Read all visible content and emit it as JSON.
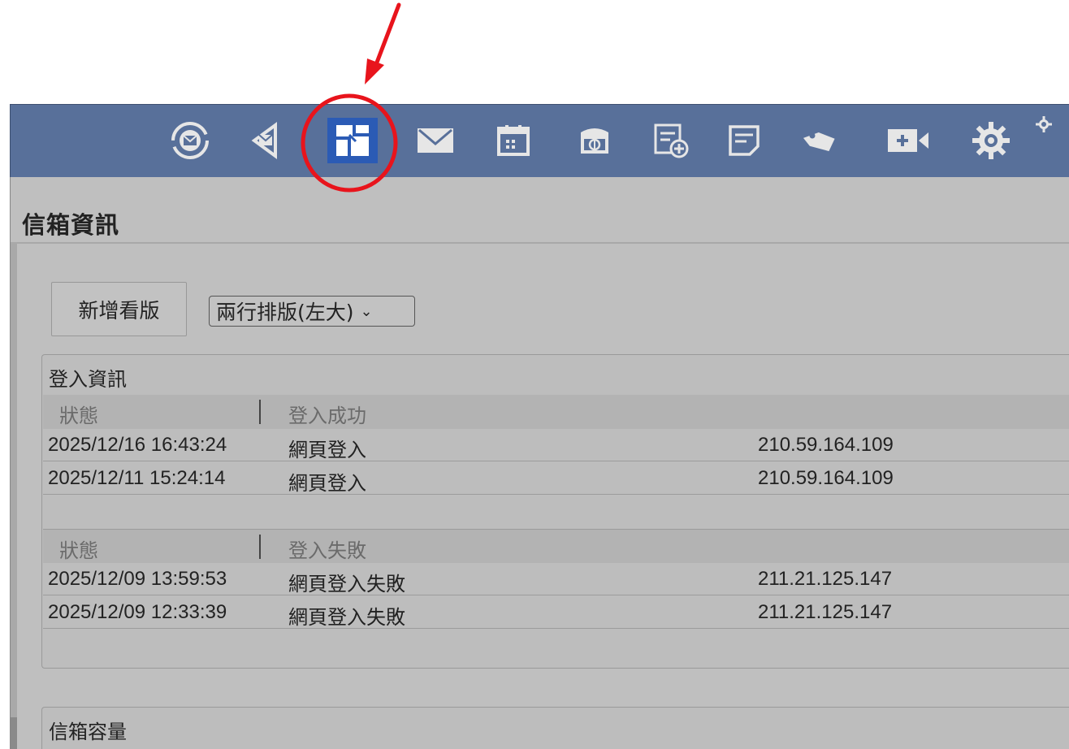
{
  "toolbar": {
    "icons": [
      {
        "name": "sync-mail-icon"
      },
      {
        "name": "send-mail-icon"
      },
      {
        "name": "dashboard-icon",
        "active": true
      },
      {
        "name": "envelope-icon"
      },
      {
        "name": "calendar-icon"
      },
      {
        "name": "storage-icon"
      },
      {
        "name": "new-note-icon"
      },
      {
        "name": "memo-icon"
      },
      {
        "name": "tag-icon"
      },
      {
        "name": "video-icon"
      },
      {
        "name": "gear-icon"
      },
      {
        "name": "small-gear-icon"
      }
    ],
    "colors": {
      "bar": "#58709a",
      "active": "#2b5bb5"
    }
  },
  "page": {
    "title": "信箱資訊",
    "add_board_label": "新增看版",
    "layout_select_value": "兩行排版(左大)"
  },
  "login_panel": {
    "title": "登入資訊",
    "success_group": {
      "status_label": "狀態",
      "status_value": "登入成功",
      "rows": [
        {
          "time": "2025/12/16 16:43:24",
          "type": "網頁登入",
          "ip": "210.59.164.109"
        },
        {
          "time": "2025/12/11 15:24:14",
          "type": "網頁登入",
          "ip": "210.59.164.109"
        }
      ]
    },
    "failure_group": {
      "status_label": "狀態",
      "status_value": "登入失敗",
      "rows": [
        {
          "time": "2025/12/09 13:59:53",
          "type": "網頁登入失敗",
          "ip": "211.21.125.147"
        },
        {
          "time": "2025/12/09 12:33:39",
          "type": "網頁登入失敗",
          "ip": "211.21.125.147"
        }
      ]
    }
  },
  "capacity_panel": {
    "title": "信箱容量"
  },
  "annotation": {
    "color": "#e8141c"
  }
}
